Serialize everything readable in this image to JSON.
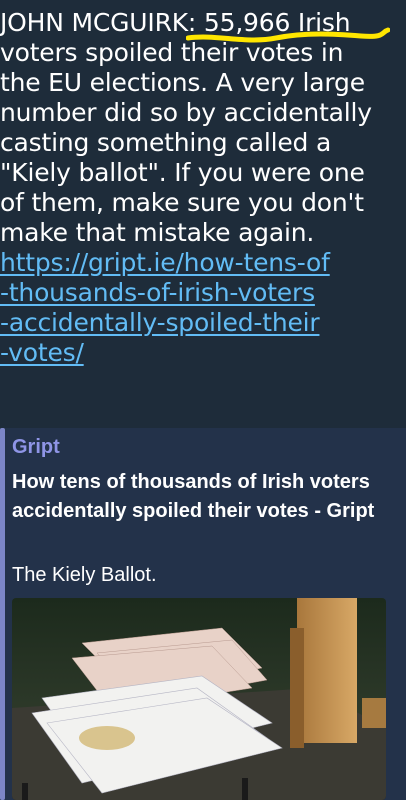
{
  "message": {
    "lines": [
      "JOHN MCGUIRK: 55,966 Irish",
      "voters spoiled their votes in",
      "the EU elections. A very large",
      "number did so by accidentally",
      "casting something called a",
      "\"Kiely ballot\". If you were one",
      "of them, make sure you don't",
      "make that mistake again."
    ],
    "link_lines": [
      "https://gript.ie/how-tens-of",
      "-thousands-of-irish-voters",
      "-accidentally-spoiled-their",
      "-votes/"
    ]
  },
  "preview": {
    "site_name": "Gript",
    "title": "How tens of thousands of Irish voters accidentally spoiled their votes - Gript",
    "description": "The Kiely Ballot.",
    "image_icon": "ballot-papers-photo"
  },
  "colors": {
    "background": "#1e2c3a",
    "link": "#62bcf5",
    "accent_bar": "#7c86c7",
    "site_name": "#8f95e6",
    "highlight": "#ffe600"
  }
}
